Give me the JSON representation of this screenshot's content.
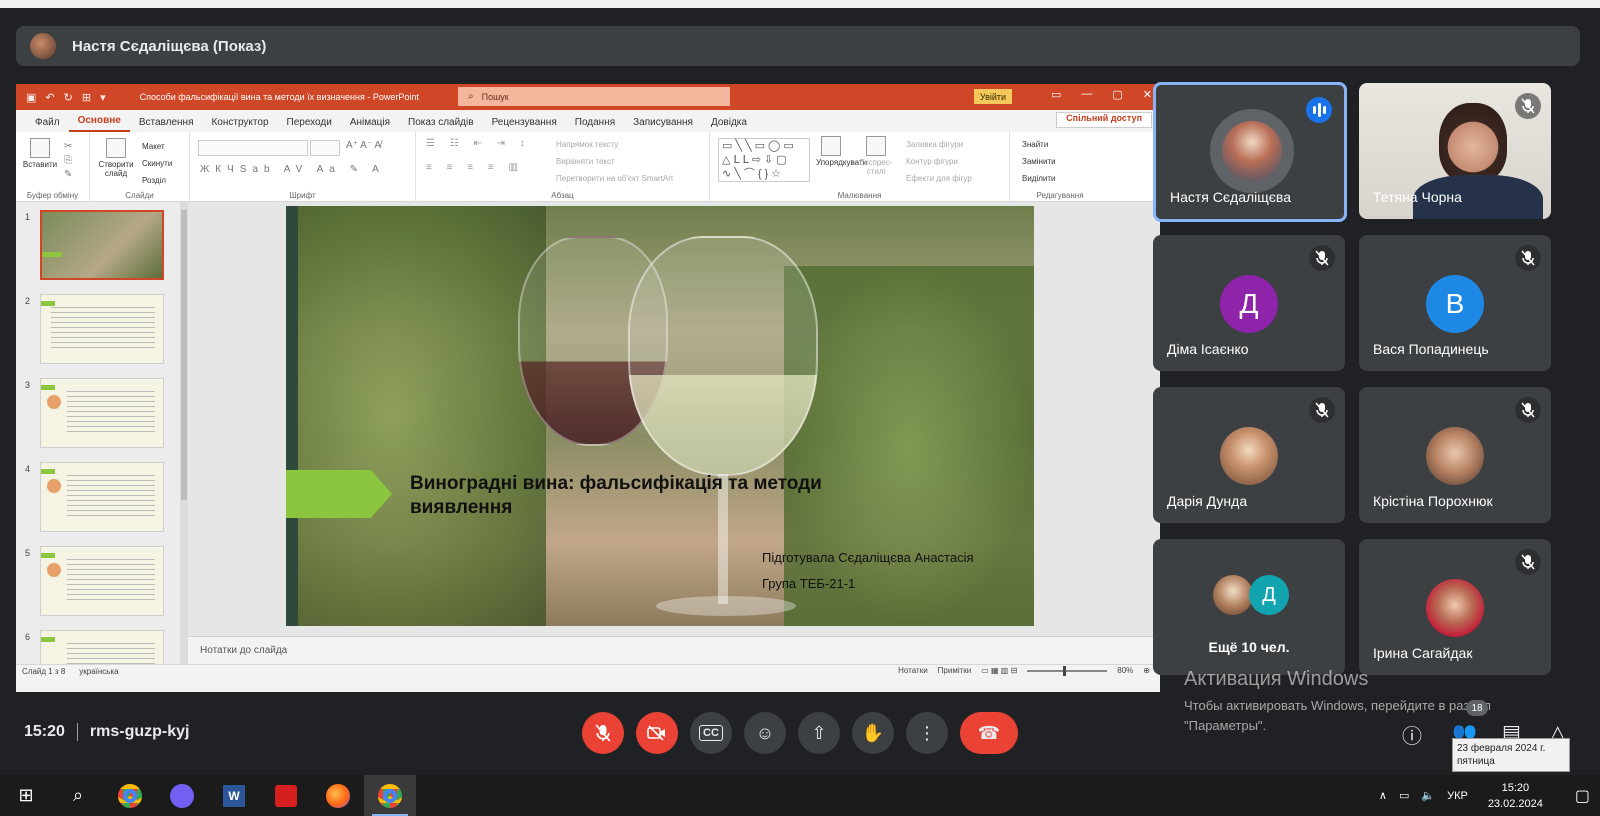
{
  "meet": {
    "presenter_bar": "Настя Сєдаліщєва (Показ)",
    "time": "15:20",
    "meeting_code": "rms-guzp-kyj",
    "participant_count": "18"
  },
  "ppt": {
    "title": "Способи фальсифікації вина та методи їх визначення  -  PowerPoint",
    "search_placeholder": "Пошук",
    "signin": "Увійти",
    "share": "Спільний доступ",
    "tabs": [
      "Файл",
      "Основне",
      "Вставлення",
      "Конструктор",
      "Переходи",
      "Анімація",
      "Показ слайдів",
      "Рецензування",
      "Подання",
      "Записування",
      "Довідка"
    ],
    "groups": {
      "clipboard": "Буфер обміну",
      "slides": "Слайди",
      "font": "Шрифт",
      "paragraph": "Абзац",
      "drawing": "Малювання",
      "editing": "Редагування"
    },
    "buttons": {
      "paste": "Вставити",
      "new_slide": "Створити слайд",
      "layout": "Макет",
      "reset": "Скинути",
      "section": "Розділ",
      "text_direction": "Напрямок тексту",
      "align_text": "Вирівняти текст",
      "smartart": "Перетворити на об'єкт SmartArt",
      "arrange": "Упорядкувати",
      "quick_styles": "Експрес-стилі",
      "shape_fill": "Заливка фігури",
      "shape_outline": "Контур фігури",
      "shape_effects": "Ефекти для фігур",
      "find": "Знайти",
      "replace": "Замінити",
      "select": "Виділити"
    },
    "thumbnail_numbers": [
      "1",
      "2",
      "3",
      "4",
      "5",
      "6"
    ],
    "slide": {
      "title": "Виноградні вина: фальсифікація та методи виявлення",
      "author": "Підготувала Сєдаліщєва Анастасія",
      "group": "Група ТЕБ-21-1"
    },
    "notes": "Нотатки до слайда",
    "status": {
      "slide_of": "Слайд 1 з 8",
      "language": "українська",
      "notes_btn": "Нотатки",
      "comments_btn": "Примітки",
      "zoom": "80%"
    }
  },
  "participants": [
    {
      "name": "Настя Сєдаліщєва",
      "initial": "",
      "color": "",
      "speaking": true
    },
    {
      "name": "Тетяна Чорна",
      "initial": "",
      "color": "",
      "muted": true
    },
    {
      "name": "Діма Ісаєнко",
      "initial": "Д",
      "color": "#8e24aa",
      "muted": true
    },
    {
      "name": "Вася Попадинець",
      "initial": "В",
      "color": "#1e88e5",
      "muted": true
    },
    {
      "name": "Дарія Дунда",
      "initial": "",
      "color": "",
      "muted": true
    },
    {
      "name": "Крістіна Порохнюк",
      "initial": "",
      "color": "",
      "muted": true
    },
    {
      "name": "Ещё 10 чел.",
      "initial": "Д",
      "color": "#12a4af"
    },
    {
      "name": "Ірина Сагайдак",
      "initial": "",
      "color": "",
      "muted": true
    }
  ],
  "windows": {
    "activation_title": "Активация Windows",
    "activation_text": "Чтобы активировать Windows, перейдите в раздел \"Параметры\".",
    "tooltip_date": "23 февраля 2024 г.",
    "tooltip_day": "пятница",
    "lang": "УКР",
    "clock_time": "15:20",
    "clock_date": "23.02.2024"
  },
  "colors": {
    "meet_bg": "#202124",
    "tile_bg": "#3c4043",
    "ppt_accent": "#d04727",
    "slide_arrow": "#8cc63f",
    "danger": "#ea4335"
  }
}
